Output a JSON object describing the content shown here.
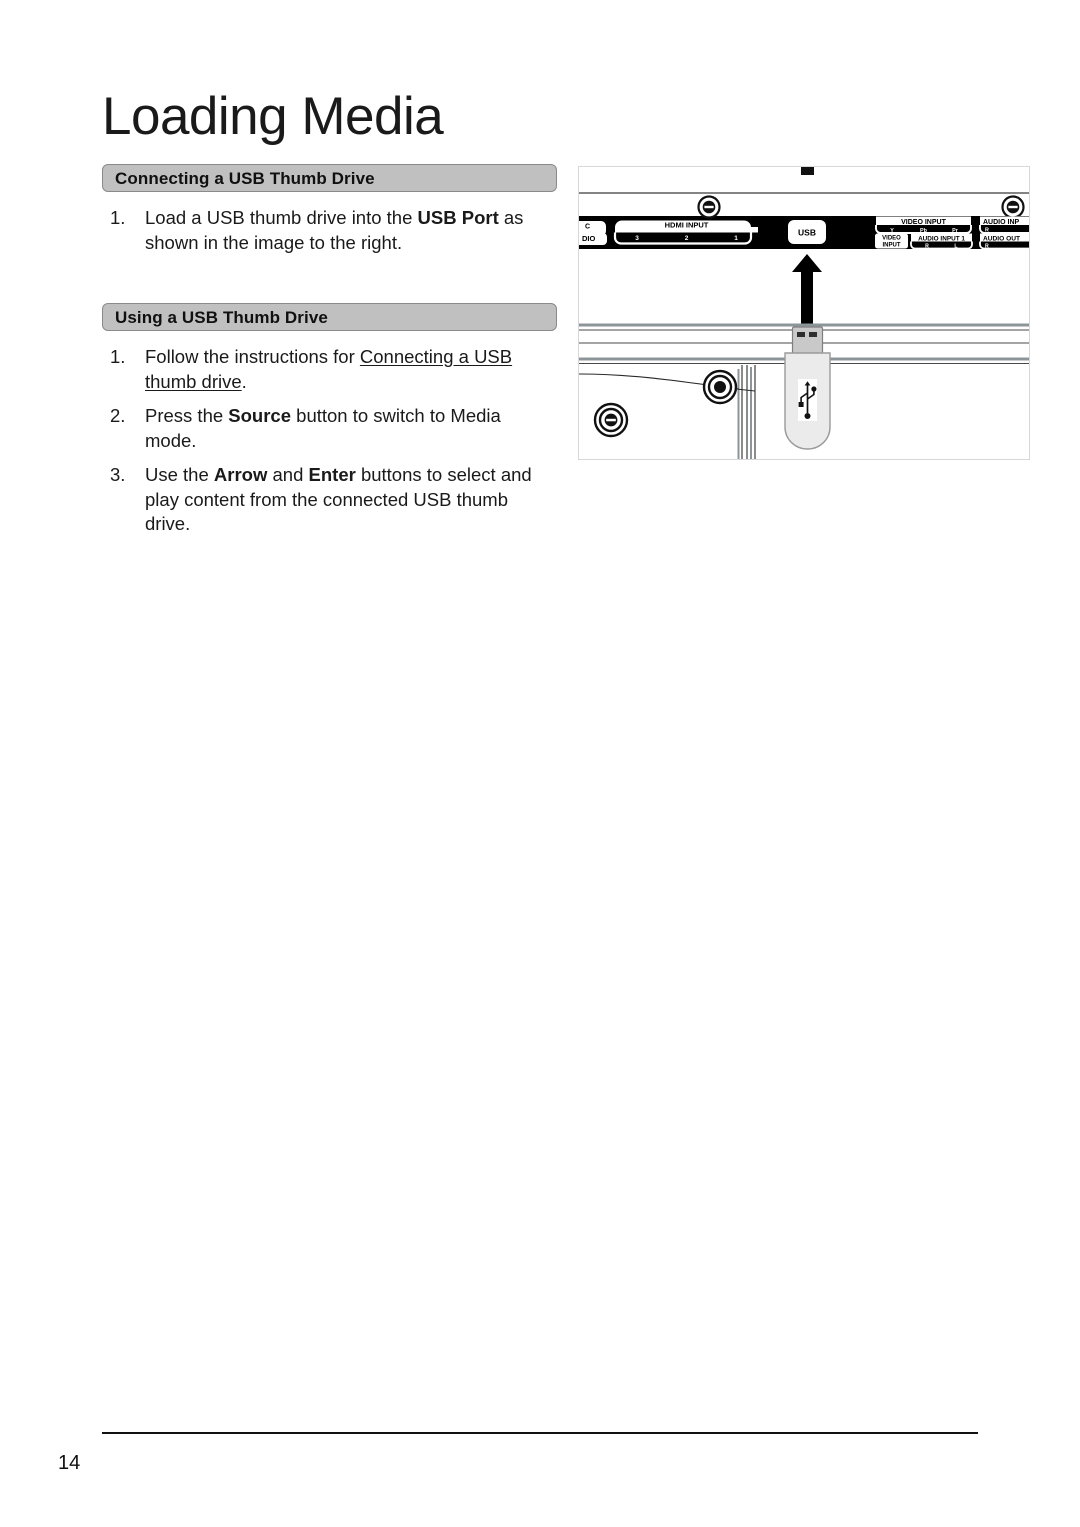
{
  "page": {
    "title": "Loading Media",
    "number": "14"
  },
  "sections": [
    {
      "header": "Connecting a USB Thumb Drive",
      "steps": [
        {
          "number": "1.",
          "parts": [
            {
              "text": "Load a USB thumb drive into the ",
              "style": "normal"
            },
            {
              "text": "USB Port",
              "style": "bold"
            },
            {
              "text": " as shown in the image to the right.",
              "style": "normal"
            }
          ]
        }
      ]
    },
    {
      "header": "Using a USB Thumb Drive",
      "steps": [
        {
          "number": "1.",
          "parts": [
            {
              "text": "Follow the instructions for ",
              "style": "normal"
            },
            {
              "text": "Connecting a USB thumb drive",
              "style": "underline"
            },
            {
              "text": ".",
              "style": "normal"
            }
          ]
        },
        {
          "number": "2.",
          "parts": [
            {
              "text": "Press the ",
              "style": "normal"
            },
            {
              "text": "Source",
              "style": "bold"
            },
            {
              "text": " button to switch to Media mode.",
              "style": "normal"
            }
          ]
        },
        {
          "number": "3.",
          "parts": [
            {
              "text": "Use the ",
              "style": "normal"
            },
            {
              "text": "Arrow",
              "style": "bold"
            },
            {
              "text": " and ",
              "style": "normal"
            },
            {
              "text": "Enter",
              "style": "bold"
            },
            {
              "text": " buttons to select and play content from the connected USB thumb drive.",
              "style": "normal"
            }
          ]
        }
      ]
    }
  ],
  "figure": {
    "caption": "Rear connector panel of the TV with a USB thumb drive being inserted into the USB port",
    "port_labels": {
      "pc_audio_left": "C",
      "pc_audio_left2": "DIO",
      "hdmi_input": "HDMI INPUT",
      "hdmi_numbers": [
        "3",
        "2",
        "1"
      ],
      "usb": "USB",
      "video_input": "VIDEO INPUT",
      "component_labels": [
        "Y",
        "Pb",
        "Pr"
      ],
      "video_input_box_line1": "VIDEO",
      "video_input_box_line2": "INPUT",
      "audio_input_1": "AUDIO INPUT 1",
      "audio_input_1_channels": [
        "R",
        "L"
      ],
      "audio_input_right": "AUDIO INP",
      "audio_input_right_channel": "R",
      "audio_out_right": "AUDIO OUT",
      "audio_out_right_channel": "R"
    },
    "colors": {
      "panel_black": "#000000",
      "label_white": "#ffffff",
      "drive_body": "#ebebeb",
      "drive_connector": "#c9c9c9",
      "arrow": "#000000"
    }
  }
}
